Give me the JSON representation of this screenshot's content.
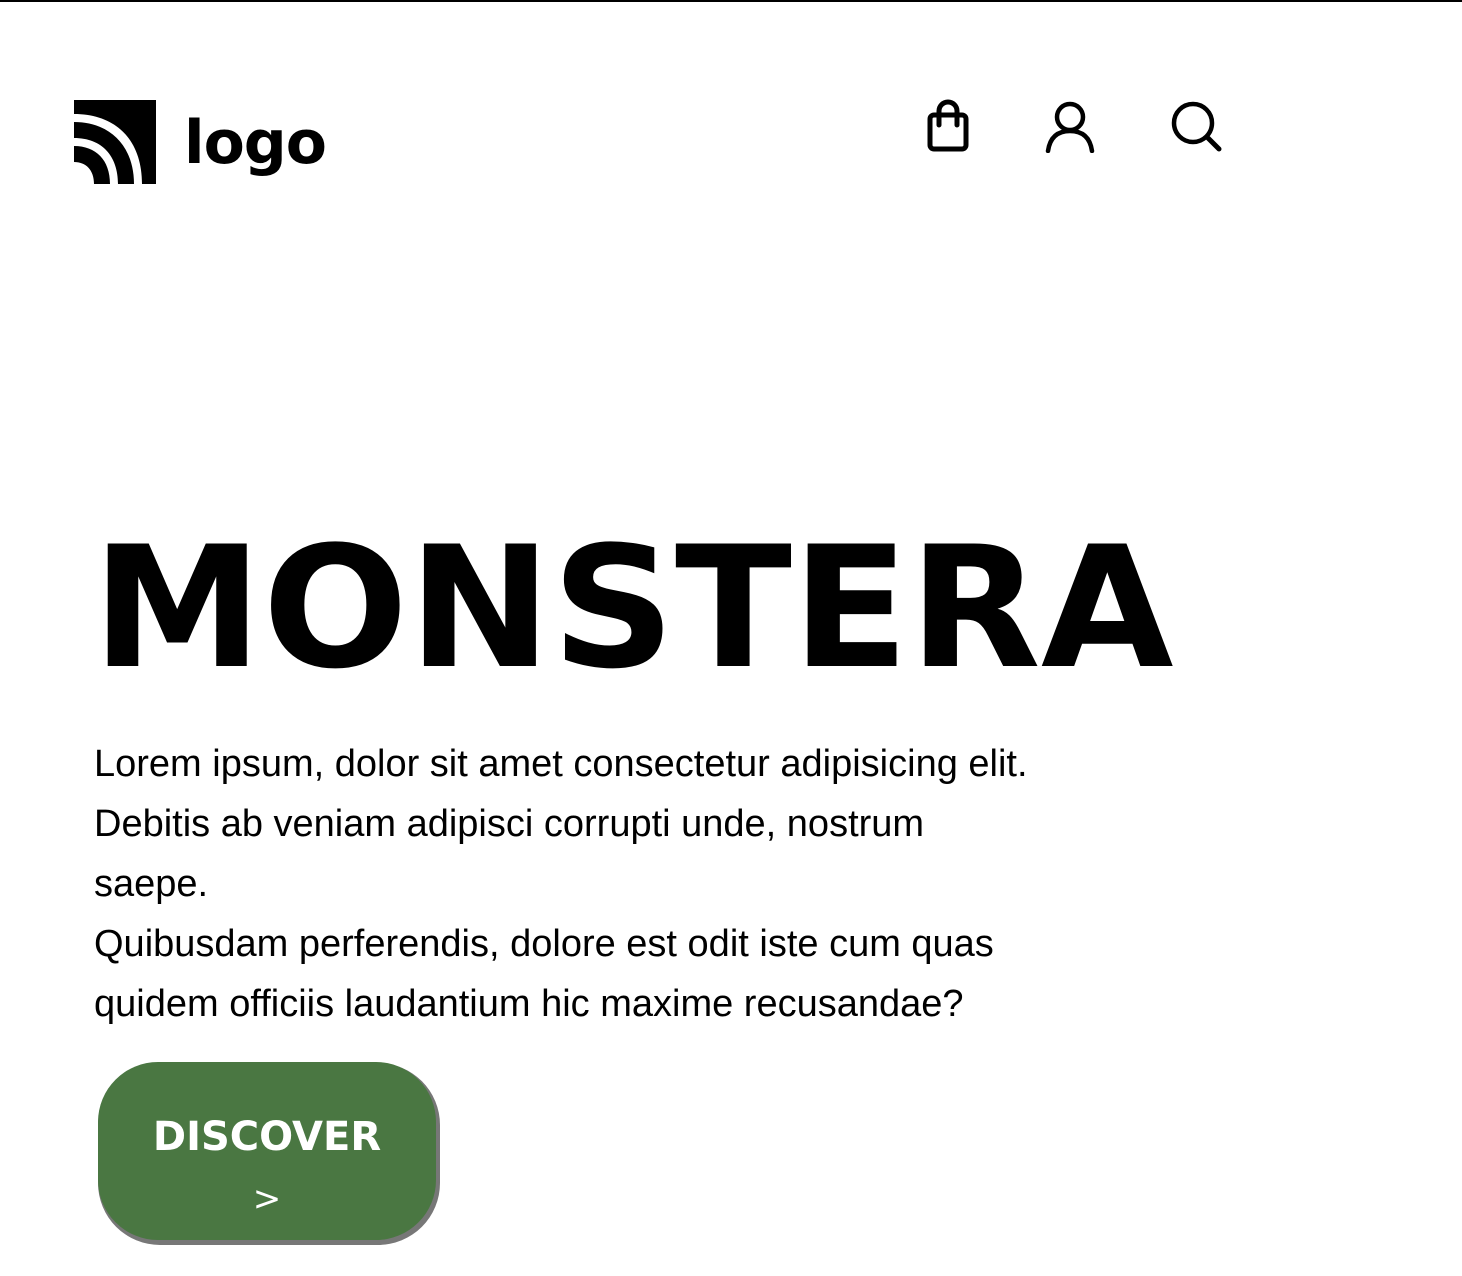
{
  "header": {
    "logo_text": "logo",
    "icons": {
      "cart": "shopping-bag-icon",
      "account": "user-icon",
      "search": "search-icon"
    }
  },
  "hero": {
    "title": "MONSTERA",
    "paragraph_lines": [
      "Lorem ipsum, dolor sit amet consectetur adipisicing elit.",
      "Debitis ab veniam adipisci corrupti unde, nostrum",
      "saepe.",
      "Quibusdam perferendis, dolore est odit iste cum quas",
      "quidem officiis laudantium hic maxime recusandae?"
    ],
    "cta_label": "DISCOVER",
    "cta_arrow": ">"
  },
  "colors": {
    "button_background": "#4a7742",
    "button_text": "#ffffff",
    "text": "#000000",
    "background": "#ffffff"
  }
}
